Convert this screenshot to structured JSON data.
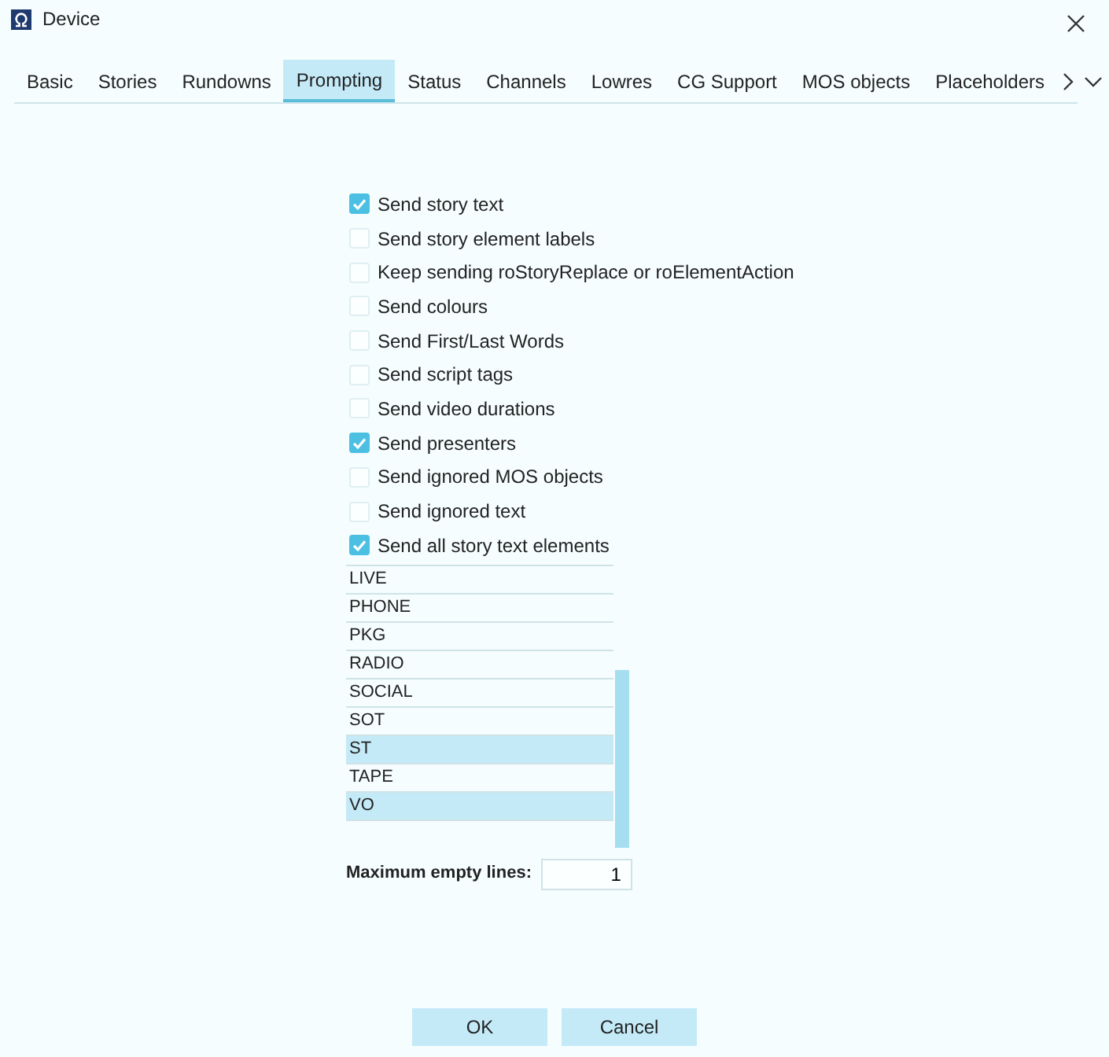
{
  "window": {
    "title": "Device"
  },
  "tabs": [
    {
      "label": "Basic",
      "selected": false
    },
    {
      "label": "Stories",
      "selected": false
    },
    {
      "label": "Rundowns",
      "selected": false
    },
    {
      "label": "Prompting",
      "selected": true
    },
    {
      "label": "Status",
      "selected": false
    },
    {
      "label": "Channels",
      "selected": false
    },
    {
      "label": "Lowres",
      "selected": false
    },
    {
      "label": "CG Support",
      "selected": false
    },
    {
      "label": "MOS objects",
      "selected": false
    },
    {
      "label": "Placeholders",
      "selected": false
    }
  ],
  "options": [
    {
      "label": "Send story text",
      "checked": true
    },
    {
      "label": "Send story element labels",
      "checked": false
    },
    {
      "label": "Keep sending roStoryReplace or roElementAction",
      "checked": false
    },
    {
      "label": "Send colours",
      "checked": false
    },
    {
      "label": "Send First/Last Words",
      "checked": false
    },
    {
      "label": "Send script tags",
      "checked": false
    },
    {
      "label": "Send video durations",
      "checked": false
    },
    {
      "label": "Send presenters",
      "checked": true
    },
    {
      "label": "Send ignored MOS objects",
      "checked": false
    },
    {
      "label": "Send ignored text",
      "checked": false
    },
    {
      "label": "Send all story text elements",
      "checked": true
    }
  ],
  "element_list": [
    {
      "label": "LIVE",
      "selected": false
    },
    {
      "label": "PHONE",
      "selected": false
    },
    {
      "label": "PKG",
      "selected": false
    },
    {
      "label": "RADIO",
      "selected": false
    },
    {
      "label": "SOCIAL",
      "selected": false
    },
    {
      "label": "SOT",
      "selected": false
    },
    {
      "label": "ST",
      "selected": true
    },
    {
      "label": "TAPE",
      "selected": false
    },
    {
      "label": "VO",
      "selected": true
    }
  ],
  "max_empty_lines": {
    "label": "Maximum empty lines:",
    "value": "1"
  },
  "buttons": [
    "OK",
    "Cancel"
  ]
}
